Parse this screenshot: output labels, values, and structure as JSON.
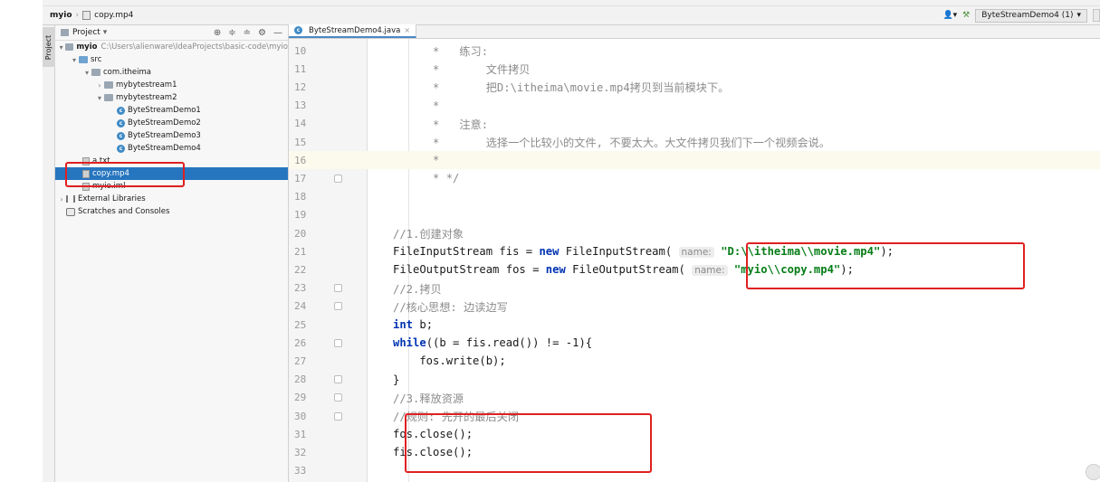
{
  "nav": {
    "project": "myio",
    "file": "copy.mp4",
    "run_config": "ByteStreamDemo4 (1)"
  },
  "project_panel": {
    "title": "Project",
    "stripe_label": "Project",
    "tree": [
      {
        "label": "myio",
        "extra": "C:\\Users\\alienware\\IdeaProjects\\basic-code\\myio"
      },
      {
        "label": "src"
      },
      {
        "label": "com.itheima"
      },
      {
        "label": "mybytestream1"
      },
      {
        "label": "mybytestream2"
      },
      {
        "label": "ByteStreamDemo1"
      },
      {
        "label": "ByteStreamDemo2"
      },
      {
        "label": "ByteStreamDemo3"
      },
      {
        "label": "ByteStreamDemo4"
      },
      {
        "label": "a.txt"
      },
      {
        "label": "copy.mp4"
      },
      {
        "label": "myio.iml"
      },
      {
        "label": "External Libraries"
      },
      {
        "label": "Scratches and Consoles"
      }
    ]
  },
  "editor": {
    "tab": "ByteStreamDemo4.java",
    "lines": [
      {
        "n": "10",
        "t": "      *   练习:"
      },
      {
        "n": "11",
        "t": "      *       文件拷贝"
      },
      {
        "n": "12",
        "t": "      *       把D:\\itheima\\movie.mp4拷贝到当前模块下。"
      },
      {
        "n": "13",
        "t": "      *"
      },
      {
        "n": "14",
        "t": "      *   注意:"
      },
      {
        "n": "15",
        "t": "      *       选择一个比较小的文件, 不要太大。大文件拷贝我们下一个视频会说。"
      },
      {
        "n": "16",
        "t": "      *"
      },
      {
        "n": "17",
        "t": "      * */"
      },
      {
        "n": "18",
        "t": ""
      },
      {
        "n": "19",
        "t": ""
      },
      {
        "n": "20",
        "t": "//1.创建对象"
      },
      {
        "n": "21",
        "t": "FileInputStream fis = new FileInputStream( name: \"D:\\\\itheima\\\\movie.mp4\");"
      },
      {
        "n": "22",
        "t": "FileOutputStream fos = new FileOutputStream( name: \"myio\\\\copy.mp4\");"
      },
      {
        "n": "23",
        "t": "//2.拷贝"
      },
      {
        "n": "24",
        "t": "//核心思想: 边读边写"
      },
      {
        "n": "25",
        "t": "int b;"
      },
      {
        "n": "26",
        "t": "while((b = fis.read()) != -1){"
      },
      {
        "n": "27",
        "t": "    fos.write(b);"
      },
      {
        "n": "28",
        "t": "}"
      },
      {
        "n": "29",
        "t": "//3.释放资源"
      },
      {
        "n": "30",
        "t": "//规则: 先开的最后关闭"
      },
      {
        "n": "31",
        "t": "fos.close();"
      },
      {
        "n": "32",
        "t": "fis.close();"
      },
      {
        "n": "33",
        "t": ""
      }
    ]
  }
}
